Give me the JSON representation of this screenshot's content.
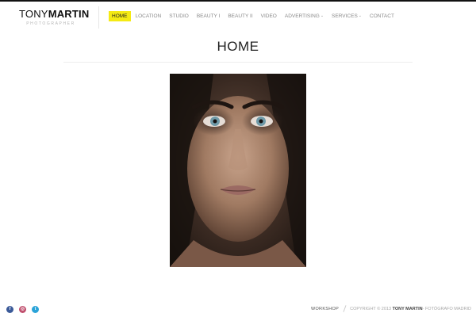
{
  "logo": {
    "first": "TONY",
    "last": "MARTIN",
    "subtitle": "PHOTOGRAPHER"
  },
  "nav": {
    "items": [
      {
        "label": "HOME",
        "active": true
      },
      {
        "label": "LOCATION"
      },
      {
        "label": "STUDIO"
      },
      {
        "label": "BEAUTY I"
      },
      {
        "label": "BEAUTY II"
      },
      {
        "label": "VIDEO"
      },
      {
        "label": "ADVERTISING",
        "caret": "⌄"
      },
      {
        "label": "SERVICES",
        "caret": "⌄"
      },
      {
        "label": "CONTACT"
      }
    ]
  },
  "page": {
    "title": "HOME"
  },
  "colors": {
    "accent": "#f5ea14",
    "facebook": "#3b5a99",
    "instagram": "#c0506e",
    "twitter": "#2aa3d8"
  },
  "social": [
    {
      "icon": "facebook-icon",
      "glyph": "f"
    },
    {
      "icon": "instagram-icon",
      "glyph": "◎"
    },
    {
      "icon": "twitter-icon",
      "glyph": "t"
    }
  ],
  "footer": {
    "link": "WORKSHOP",
    "copyright": "COPYRIGHT © 2013",
    "name": "TONY MARTIN",
    "suffix": " - FOTÓGRAFO MADRID"
  }
}
